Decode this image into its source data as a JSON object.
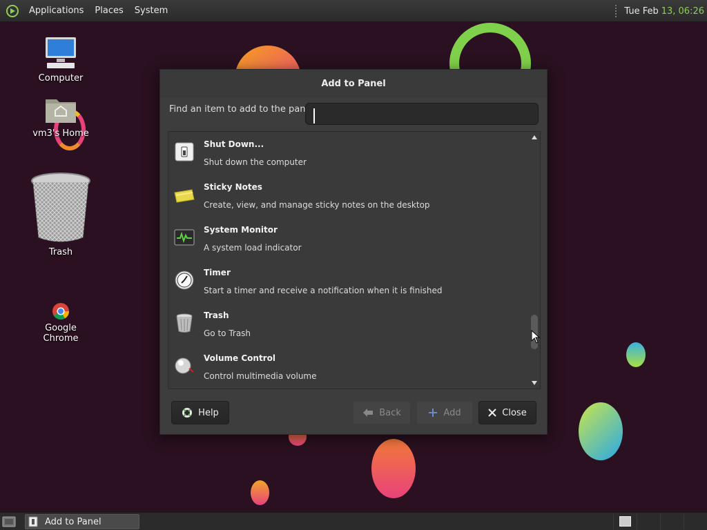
{
  "top_panel": {
    "menus": [
      "Applications",
      "Places",
      "System"
    ],
    "clock_date": "Tue Feb",
    "clock_time": "13, 06:26"
  },
  "desktop_icons": [
    {
      "label": "Computer",
      "icon": "computer-icon"
    },
    {
      "label": "vm3's Home",
      "icon": "home-folder-icon"
    },
    {
      "label": "Trash",
      "icon": "trash-icon"
    },
    {
      "label": "Google Chrome",
      "icon": "chrome-icon"
    }
  ],
  "dialog": {
    "title": "Add to Panel",
    "find_label": "Find an item to add to the panel:",
    "find_value": "",
    "items": [
      {
        "name": "Shut Down...",
        "desc": "Shut down the computer",
        "icon": "shutdown-icon"
      },
      {
        "name": "Sticky Notes",
        "desc": "Create, view, and manage sticky notes on the desktop",
        "icon": "sticky-notes-icon"
      },
      {
        "name": "System Monitor",
        "desc": "A system load indicator",
        "icon": "system-monitor-icon"
      },
      {
        "name": "Timer",
        "desc": "Start a timer and receive a notification when it is finished",
        "icon": "timer-icon"
      },
      {
        "name": "Trash",
        "desc": "Go to Trash",
        "icon": "trash-icon"
      },
      {
        "name": "Volume Control",
        "desc": "Control multimedia volume",
        "icon": "volume-icon"
      }
    ],
    "buttons": {
      "help": "Help",
      "back": "Back",
      "add": "Add",
      "close": "Close"
    }
  },
  "bottom_panel": {
    "task_label": "Add to Panel"
  },
  "colors": {
    "accent_green": "#8fce5a",
    "dialog_bg": "#3d3d3d"
  }
}
